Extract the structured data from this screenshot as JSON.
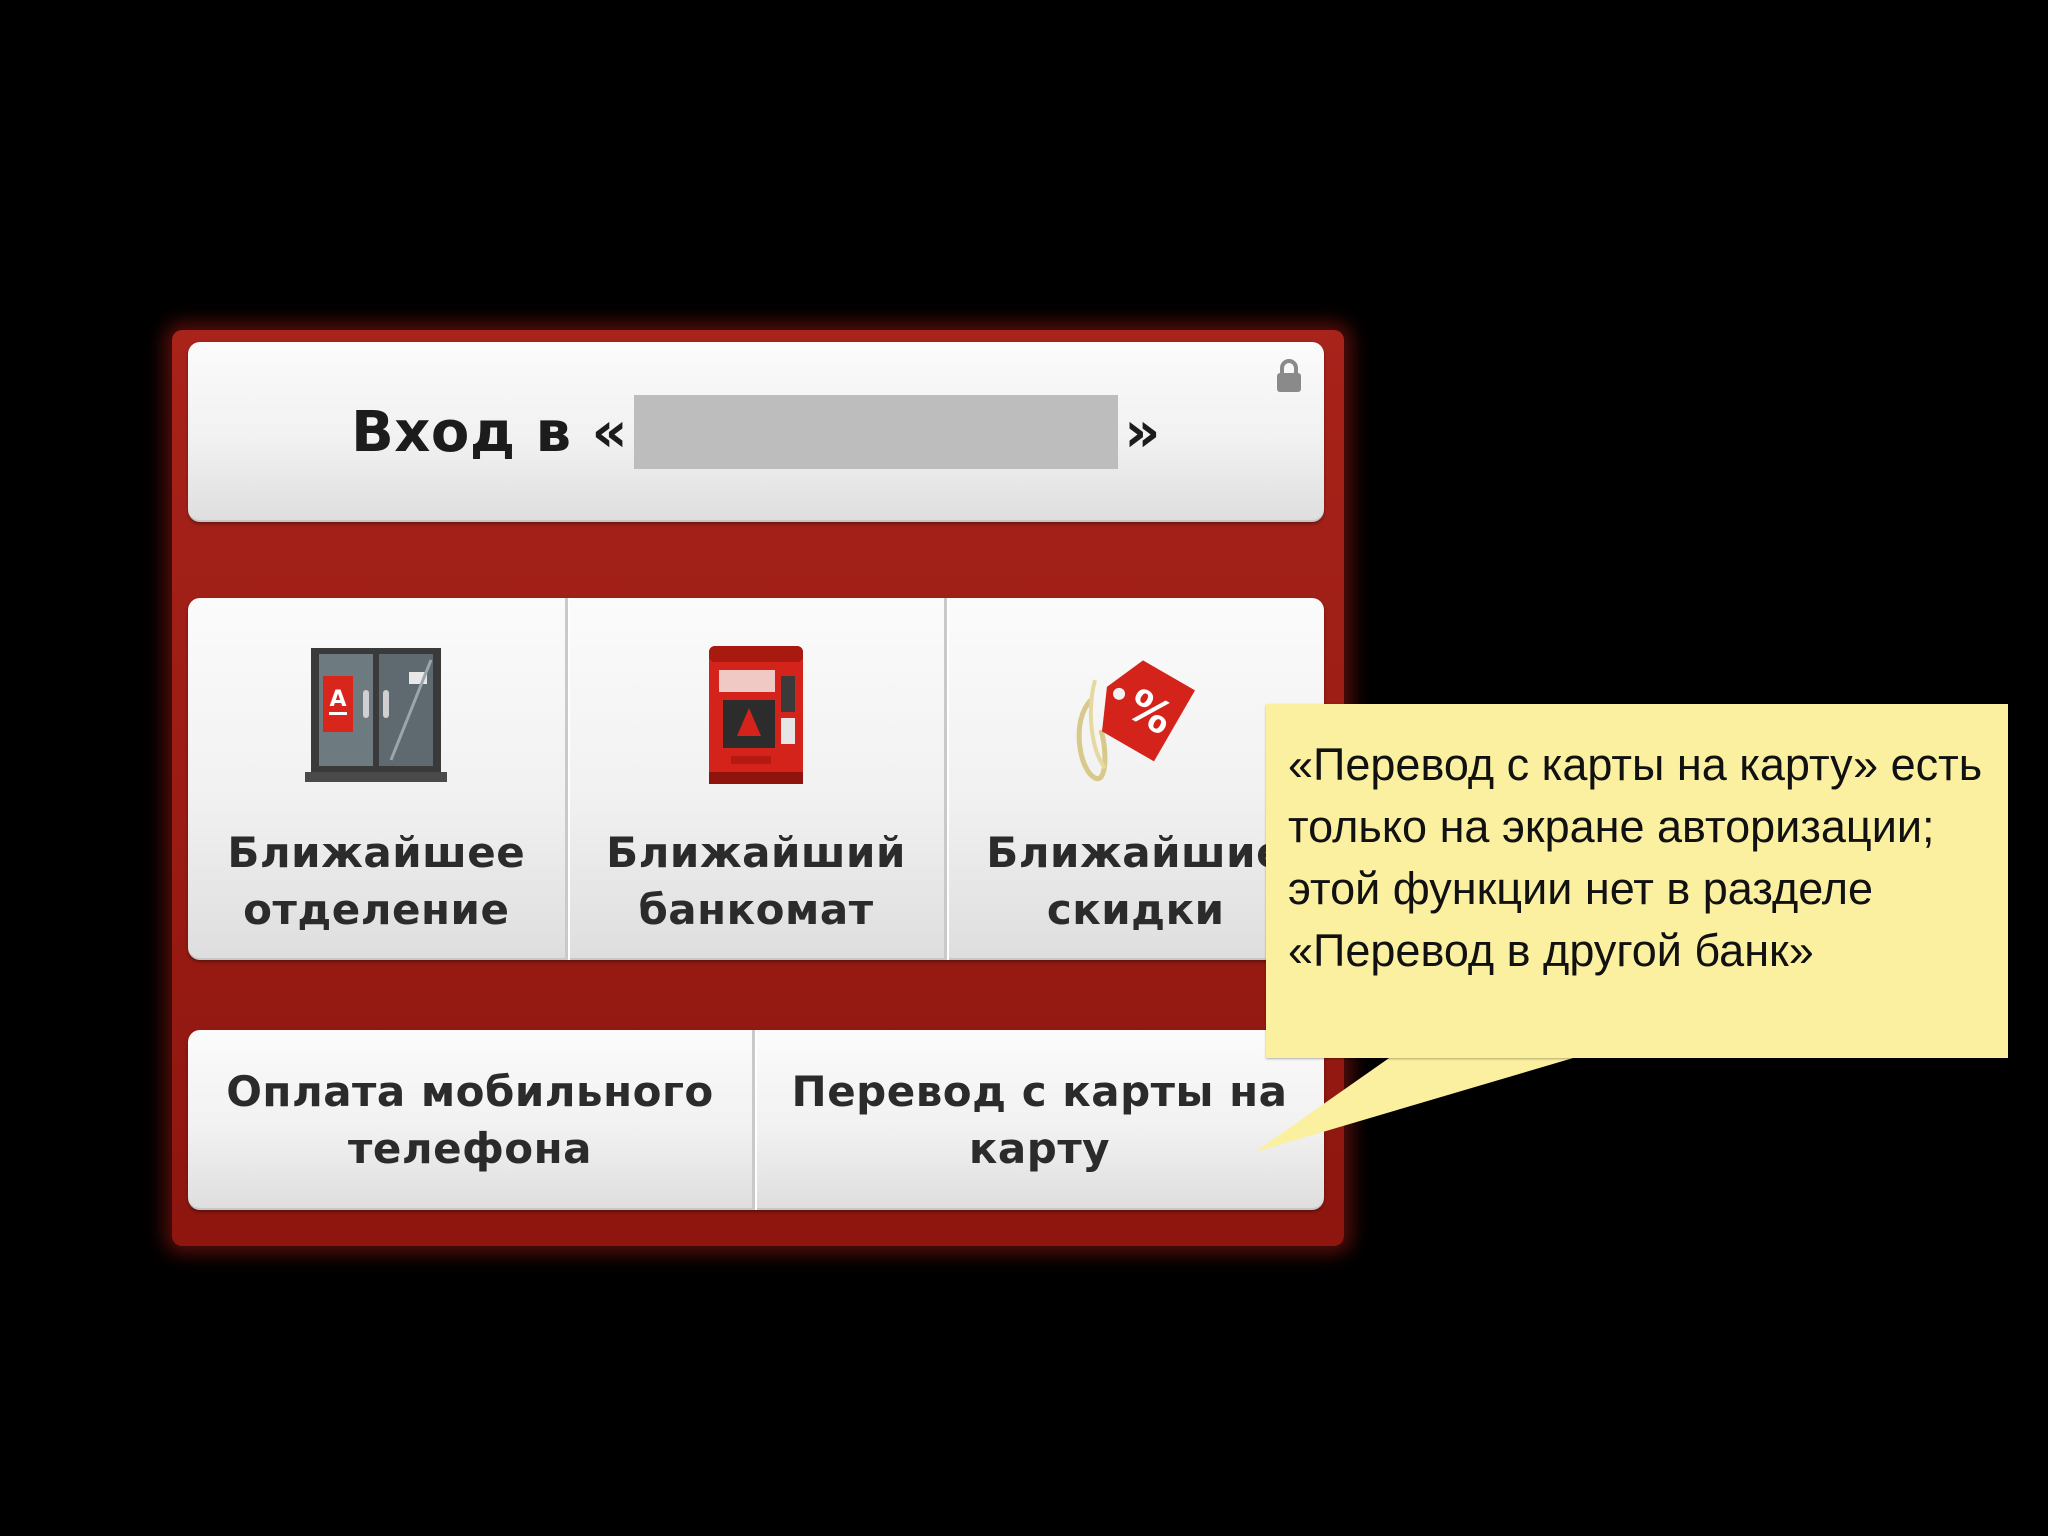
{
  "login": {
    "prefix": "Вход в «",
    "suffix": "»",
    "lock_icon": "lock-icon"
  },
  "tiles": [
    {
      "label": "Ближайшее\nотделение",
      "icon": "branch-door-icon"
    },
    {
      "label": "Ближайший\nбанкомат",
      "icon": "atm-icon"
    },
    {
      "label": "Ближайшие\nскидки",
      "icon": "discount-tag-icon"
    }
  ],
  "actions": {
    "mobile_payment": "Оплата мобильного\nтелефона",
    "card_transfer": "Перевод с карты на\nкарту"
  },
  "callout": {
    "text": "«Перевод с карты на карту» есть только на экране авторизации; этой функции нет в разделе «Перевод в другой банк»"
  },
  "colors": {
    "background": "#000000",
    "panel_red": "#9b1c14",
    "callout_yellow": "#fbf09f",
    "redaction_gray": "#bdbdbd"
  }
}
